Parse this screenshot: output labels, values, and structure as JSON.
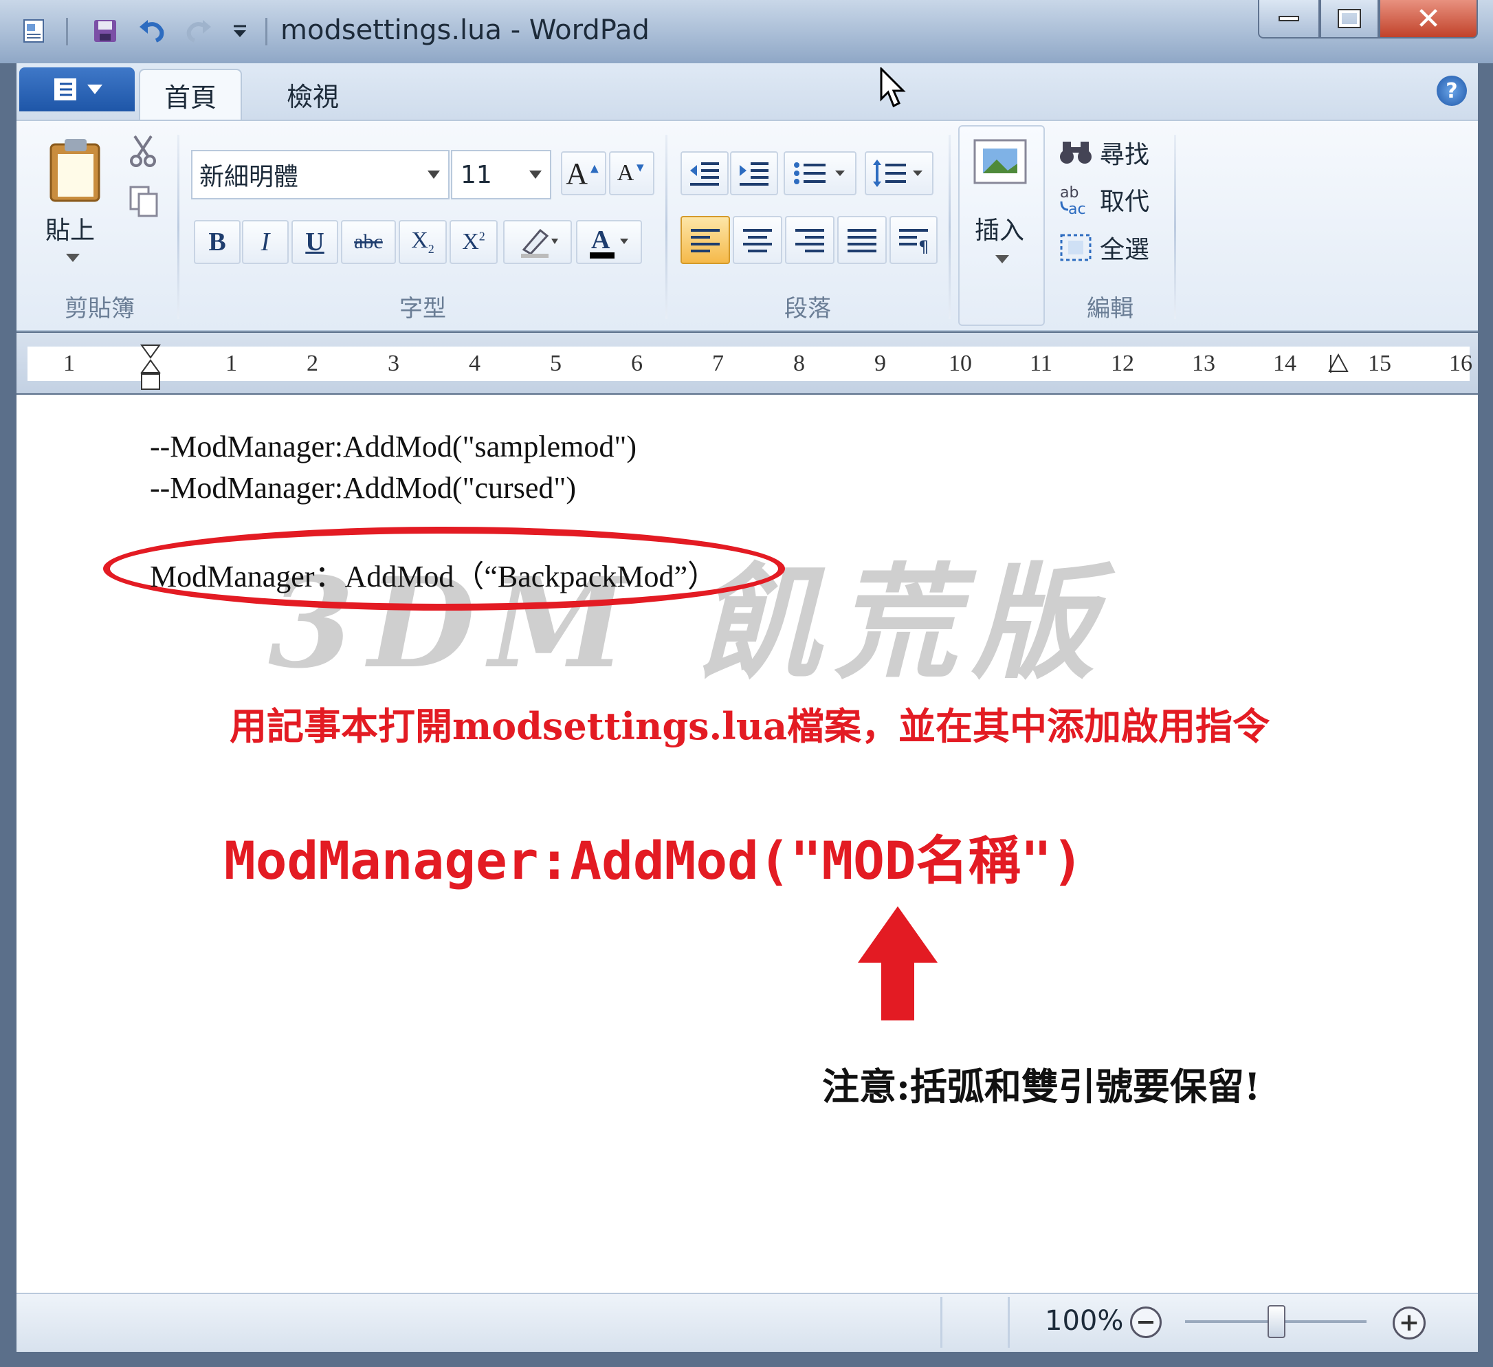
{
  "window": {
    "title": "modsettings.lua - WordPad",
    "controls": {
      "minimize": "minimize",
      "maximize": "maximize",
      "close": "close"
    }
  },
  "ribbon": {
    "tabs": [
      "首頁",
      "檢視"
    ],
    "clipboard": {
      "paste_label": "貼上",
      "group_label": "剪貼簿"
    },
    "font": {
      "font_name": "新細明體",
      "font_size": "11",
      "group_label": "字型",
      "bold": "B",
      "italic": "I",
      "underline": "U",
      "strikethrough": "abc"
    },
    "paragraph": {
      "group_label": "段落"
    },
    "insert": {
      "label": "插入"
    },
    "editing": {
      "find": "尋找",
      "replace": "取代",
      "select_all": "全選",
      "group_label": "編輯"
    }
  },
  "ruler": {
    "ticks": [
      "1",
      "1",
      "2",
      "3",
      "4",
      "5",
      "6",
      "7",
      "8",
      "9",
      "10",
      "11",
      "12",
      "13",
      "14",
      "15",
      "16"
    ]
  },
  "document": {
    "line1": "--ModManager:AddMod(\"samplemod\")",
    "line2": "--ModManager:AddMod(\"cursed\")",
    "highlighted_line": "ModManager：AddMod（“BackpackMod”）",
    "watermark": "3DM 飢荒版",
    "instruction": "用記事本打開modsettings.lua檔案，並在其中添加啟用指令",
    "command_template": "ModManager:AddMod(\"MOD名稱\")",
    "note": "注意:括弧和雙引號要保留!"
  },
  "statusbar": {
    "zoom": "100%",
    "zoom_level": 1.0
  },
  "colors": {
    "annotation_red": "#e31b23",
    "ribbon_blue": "#1e56a8"
  }
}
